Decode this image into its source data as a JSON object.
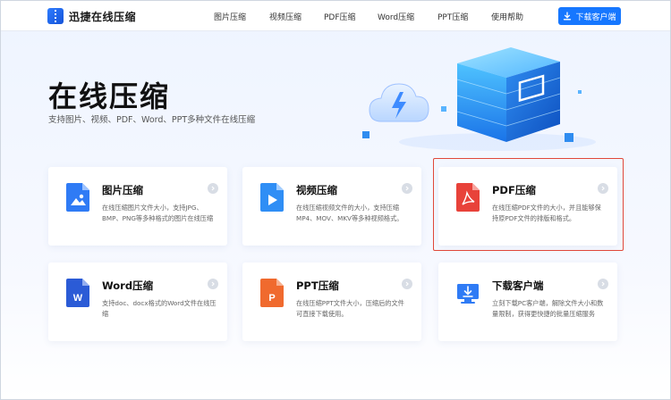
{
  "header": {
    "logo_text": "迅捷在线压缩",
    "nav": [
      {
        "label": "图片压缩"
      },
      {
        "label": "视频压缩"
      },
      {
        "label": "PDF压缩"
      },
      {
        "label": "Word压缩"
      },
      {
        "label": "PPT压缩"
      },
      {
        "label": "使用帮助"
      }
    ],
    "download_label": "下载客户端"
  },
  "hero": {
    "title": "在线压缩",
    "subtitle": "支持图片、视频、PDF、Word、PPT多种文件在线压缩"
  },
  "cards": [
    {
      "title": "图片压缩",
      "desc": "在线压缩图片文件大小，支持JPG、BMP、PNG等多种格式的图片在线压缩",
      "icon": "image-file-icon",
      "color": "#2f7bf5"
    },
    {
      "title": "视频压缩",
      "desc": "在线压缩视频文件的大小，支持压缩MP4、MOV、MKV等多种视频格式。",
      "icon": "video-file-icon",
      "color": "#2f8ef5"
    },
    {
      "title": "PDF压缩",
      "desc": "在线压缩PDF文件的大小，并且能够保持原PDF文件的排版和格式。",
      "icon": "pdf-file-icon",
      "color": "#e8423a"
    },
    {
      "title": "Word压缩",
      "desc": "支持doc、docx格式的Word文件在线压缩",
      "icon": "word-file-icon",
      "color": "#2b5bd6"
    },
    {
      "title": "PPT压缩",
      "desc": "在线压缩PPT文件大小，压缩后的文件可直接下载使用。",
      "icon": "ppt-file-icon",
      "color": "#f06a2e"
    },
    {
      "title": "下载客户端",
      "desc": "立刻下载PC客户端，解除文件大小和数量限制，获得更快捷的批量压缩服务",
      "icon": "download-monitor-icon",
      "color": "#2f7bf5"
    }
  ],
  "colors": {
    "accent": "#1677ff",
    "highlight_border": "#e0483a"
  }
}
